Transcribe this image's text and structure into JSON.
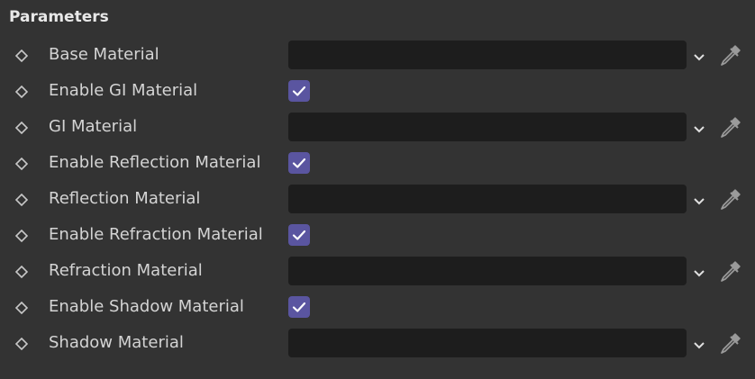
{
  "panel": {
    "title": "Parameters"
  },
  "colors": {
    "background": "#333333",
    "field": "#1d1d1d",
    "checkbox": "#5a55a0",
    "text": "#d4d4d4"
  },
  "rows": [
    {
      "label": "Base Material",
      "type": "link",
      "value": "",
      "icon": "keyframe-diamond-icon"
    },
    {
      "label": "Enable GI Material",
      "type": "checkbox",
      "checked": true,
      "icon": "keyframe-diamond-icon"
    },
    {
      "label": "GI Material",
      "type": "link",
      "value": "",
      "icon": "keyframe-diamond-icon"
    },
    {
      "label": "Enable Reflection Material",
      "type": "checkbox",
      "checked": true,
      "icon": "keyframe-diamond-icon"
    },
    {
      "label": "Reflection Material",
      "type": "link",
      "value": "",
      "icon": "keyframe-diamond-icon"
    },
    {
      "label": "Enable Refraction Material",
      "type": "checkbox",
      "checked": true,
      "icon": "keyframe-diamond-icon"
    },
    {
      "label": "Refraction Material",
      "type": "link",
      "value": "",
      "icon": "keyframe-diamond-icon"
    },
    {
      "label": "Enable Shadow Material",
      "type": "checkbox",
      "checked": true,
      "icon": "keyframe-diamond-icon"
    },
    {
      "label": "Shadow Material",
      "type": "link",
      "value": "",
      "icon": "keyframe-diamond-icon"
    }
  ]
}
